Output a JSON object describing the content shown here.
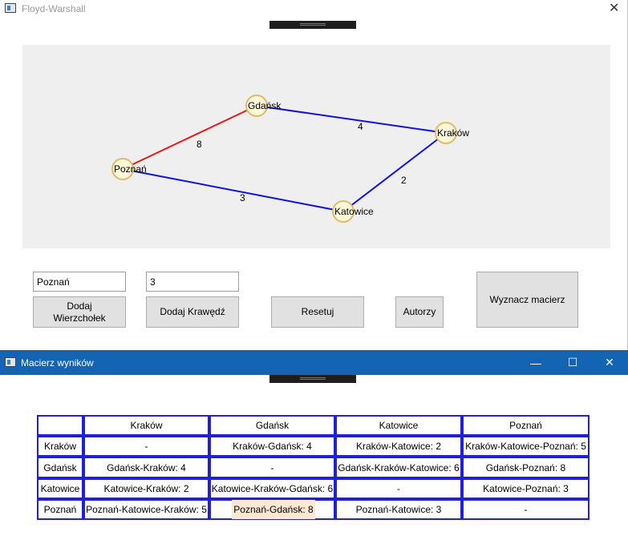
{
  "main_window": {
    "title": "Floyd-Warshall",
    "close_glyph": "✕",
    "graph": {
      "nodes": [
        {
          "label": "Gdańsk"
        },
        {
          "label": "Kraków"
        },
        {
          "label": "Poznań"
        },
        {
          "label": "Katowice"
        }
      ],
      "edges": [
        {
          "from": "Poznań",
          "to": "Gdańsk",
          "weight": "8",
          "color": "#e31b1b"
        },
        {
          "from": "Gdańsk",
          "to": "Kraków",
          "weight": "4",
          "color": "#1010e0"
        },
        {
          "from": "Poznań",
          "to": "Katowice",
          "weight": "3",
          "color": "#1010e0"
        },
        {
          "from": "Katowice",
          "to": "Kraków",
          "weight": "2",
          "color": "#1010e0"
        }
      ],
      "node_fill": "#fdf8d9",
      "node_stroke": "#e0b96a"
    },
    "vertex_input_value": "Poznań",
    "edge_input_value": "3",
    "buttons": {
      "add_vertex": "Dodaj Wierzchołek",
      "add_edge": "Dodaj Krawędź",
      "reset": "Resetuj",
      "authors": "Autorzy",
      "compute_matrix": "Wyznacz macierz"
    }
  },
  "result_window": {
    "title": "Macierz wyników",
    "minimize_glyph": "—",
    "maximize_glyph": "☐",
    "close_glyph": "✕",
    "table": {
      "columns": [
        "",
        "Kraków",
        "Gdańsk",
        "Katowice",
        "Poznań"
      ],
      "rows": [
        {
          "header": "Kraków",
          "cells": [
            "-",
            "Kraków-Gdańsk: 4",
            "Kraków-Katowice: 2",
            "Kraków-Katowice-Poznań: 5"
          ]
        },
        {
          "header": "Gdańsk",
          "cells": [
            "Gdańsk-Kraków: 4",
            "-",
            "Gdańsk-Kraków-Katowice: 6",
            "Gdańsk-Poznań: 8"
          ]
        },
        {
          "header": "Katowice",
          "cells": [
            "Katowice-Kraków: 2",
            "Katowice-Kraków-Gdańsk: 6",
            "-",
            "Katowice-Poznań: 3"
          ]
        },
        {
          "header": "Poznań",
          "cells": [
            "Poznań-Katowice-Kraków: 5",
            "Poznań-Gdańsk: 8",
            "Poznań-Katowice: 3",
            "-"
          ]
        }
      ],
      "highlight_color": "#fbe8d3",
      "border_color": "#2020d8"
    }
  }
}
